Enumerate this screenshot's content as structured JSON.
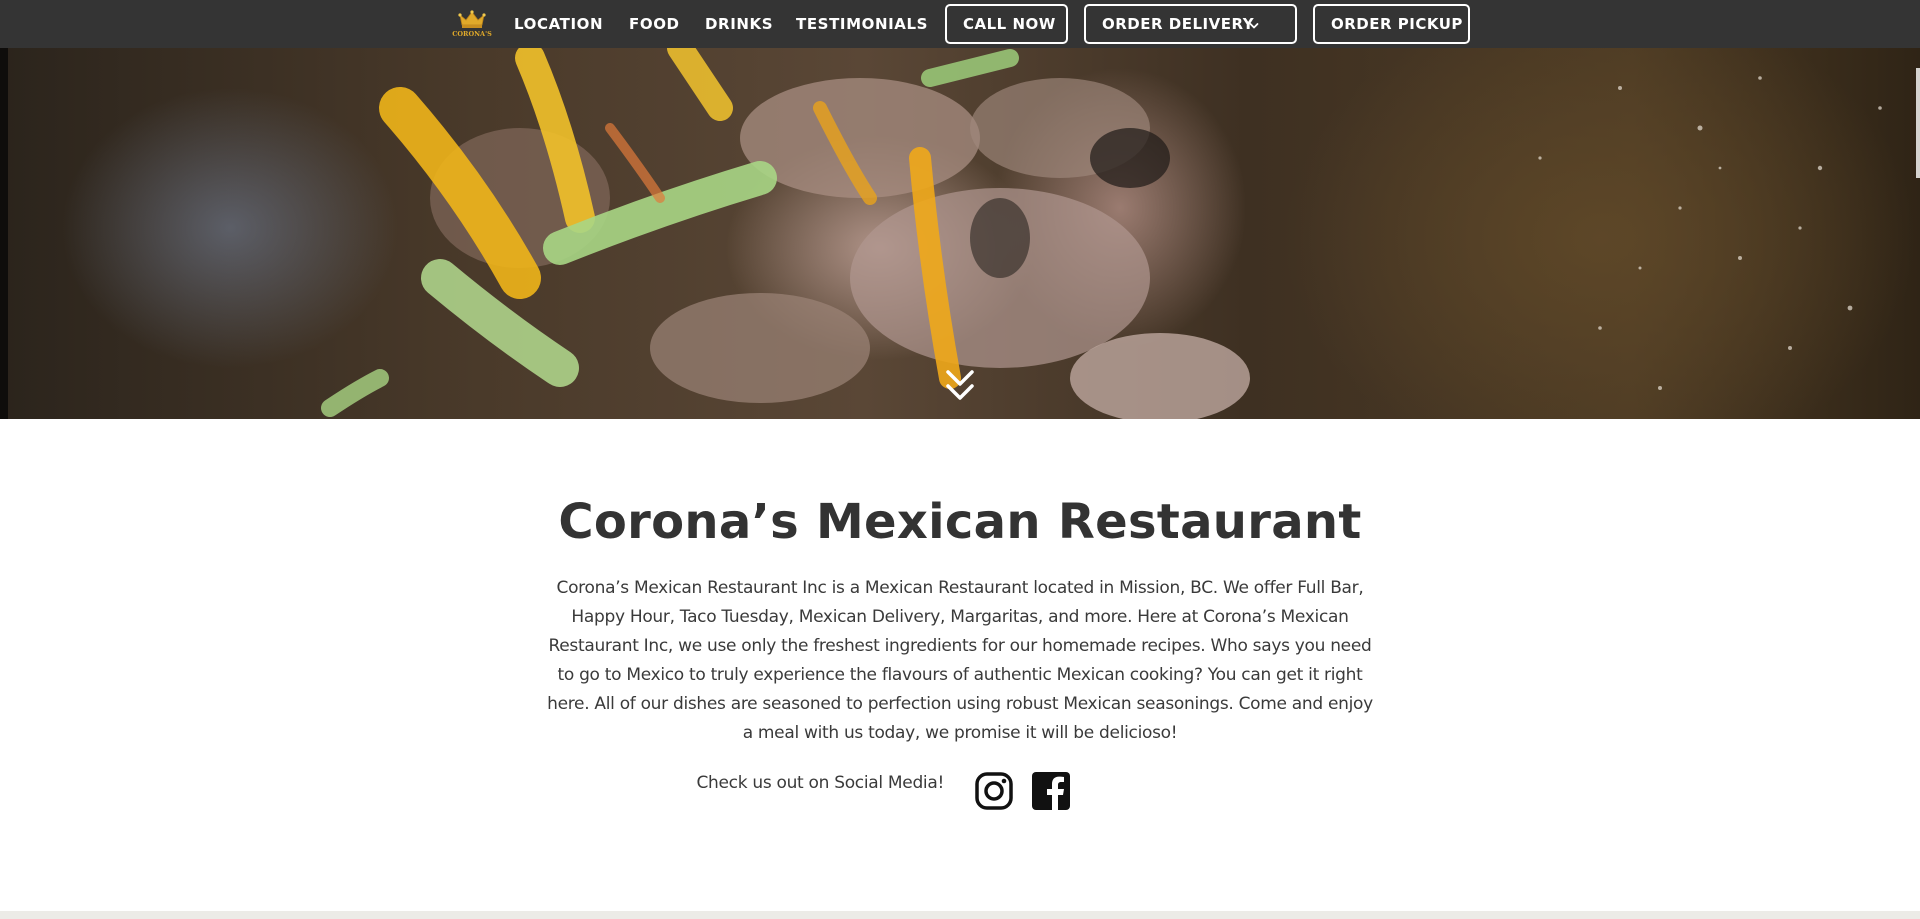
{
  "nav": {
    "logo_text": "CORONA'S",
    "links": [
      "LOCATION",
      "FOOD",
      "DRINKS",
      "TESTIMONIALS"
    ],
    "call_now": "CALL NOW",
    "order_delivery": "ORDER DELIVERY",
    "order_pickup": "ORDER PICKUP"
  },
  "hero": {
    "scroll_icon": "double-chevron-down-icon"
  },
  "main": {
    "title": "Corona’s Mexican Restaurant",
    "description": "Corona’s Mexican Restaurant Inc is a Mexican Restaurant located in Mission, BC. We offer Full Bar, Happy Hour, Taco Tuesday, Mexican Delivery, Margaritas, and more. Here at Corona’s Mexican Restaurant Inc, we use only the freshest ingredients for our homemade recipes. Who says you need to go to Mexico to truly experience the flavours of authentic Mexican cooking? You can get it right here. All of our dishes are seasoned to perfection using robust Mexican seasonings. Come and enjoy a meal with us today, we promise it will be delicioso!",
    "social_label": "Check us out on Social Media!",
    "social_icons": [
      "instagram-icon",
      "facebook-icon"
    ]
  },
  "colors": {
    "nav_bg": "#343434",
    "text": "#333333",
    "logo_gold": "#e0a92a"
  }
}
